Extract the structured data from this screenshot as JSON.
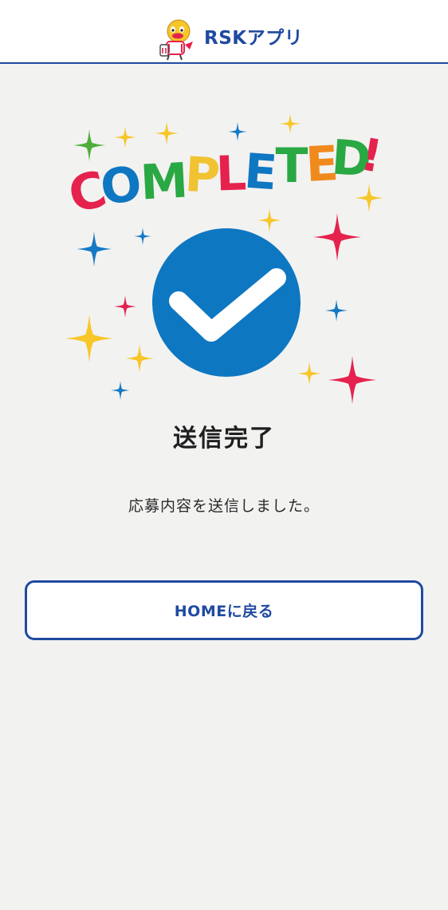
{
  "header": {
    "app_title": "RSKアプリ",
    "logo_icon": "rsk-mascot-logo-icon"
  },
  "illustration": {
    "letters": [
      {
        "char": "C",
        "color": "#e5224d"
      },
      {
        "char": "O",
        "color": "#0e77c1"
      },
      {
        "char": "M",
        "color": "#2aa843"
      },
      {
        "char": "P",
        "color": "#f1c232"
      },
      {
        "char": "L",
        "color": "#e5224d"
      },
      {
        "char": "E",
        "color": "#0e77c1"
      },
      {
        "char": "T",
        "color": "#2aa843"
      },
      {
        "char": "E",
        "color": "#f08a1d"
      },
      {
        "char": "D",
        "color": "#2aa843"
      },
      {
        "char": "!",
        "color": "#e5224d"
      }
    ],
    "check_circle_color": "#0e77c1",
    "check_icon": "checkmark-icon",
    "sparkle_icon": "sparkle-icon",
    "sparkle_colors": {
      "yellow": "#f7c628",
      "blue": "#1479c5",
      "red": "#e5224d",
      "green": "#4fae3a"
    }
  },
  "main": {
    "status_title": "送信完了",
    "status_message": "応募内容を送信しました。",
    "home_button_label": "HOMEに戻る"
  },
  "colors": {
    "brand_blue": "#1f4aa0",
    "background": "#f2f2f1"
  }
}
